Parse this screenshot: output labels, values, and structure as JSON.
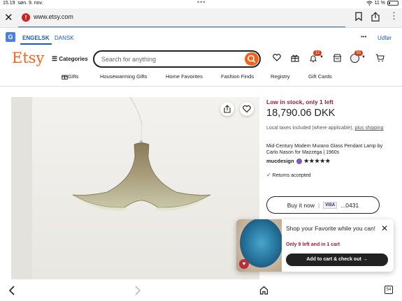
{
  "status_bar": {
    "time": "15.19",
    "date": "søn. 9. nov.",
    "battery_text": "11 %"
  },
  "address_bar": {
    "url": "www.etsy.com",
    "warning_glyph": "!"
  },
  "translate_bar": {
    "icon_text": "G",
    "lang_active": "ENGELSK",
    "lang_other": "DANSK",
    "more": "•••",
    "logout": "Udfør"
  },
  "header": {
    "logo": "Etsy",
    "categories_label": "Categories",
    "search_placeholder": "Search for anything",
    "notifications_badge": "12",
    "account_badge": "55"
  },
  "nav": {
    "gifts": "Gifts",
    "housewarming": "Housewarming Gifts",
    "home_favorites": "Home Favorites",
    "fashion": "Fashion Finds",
    "registry": "Registry",
    "gift_cards": "Gift Cards"
  },
  "product": {
    "stock": "Low in stock, only 1 left",
    "price": "18,790.06 DKK",
    "tax_text": "Local taxes included (where applicable),",
    "tax_link": "plus shipping",
    "title": "Mid-Century Modern Murano Glass Pendant Lamp by Carlo Nason for Mazzega | 1960s",
    "shop": "mucdesign",
    "stars": "★★★★★",
    "returns": "Returns accepted",
    "buy_now": "Buy it now",
    "card_brand": "VISA",
    "card_last": "...0431"
  },
  "popup": {
    "title": "Shop your Favorite while you can!",
    "left_text": "Only 9 left and in 1 cart",
    "button": "Add to cart & check out →"
  },
  "bottom_bar": {
    "tabs_count": "54"
  },
  "colors": {
    "brand": "#f1641e",
    "link": "#1a57c7",
    "alert": "#a61a2e"
  }
}
